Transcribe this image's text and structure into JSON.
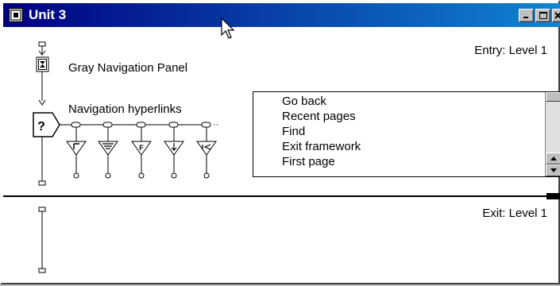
{
  "window": {
    "title": "Unit 3",
    "icon": "framework-icon",
    "controls": [
      "minimize-icon",
      "maximize-icon",
      "close-icon"
    ],
    "title_gradient": [
      "#000080",
      "#1084d0"
    ]
  },
  "flowline": {
    "entry_label": "Entry: Level 1",
    "exit_label": "Exit: Level 1",
    "items": [
      {
        "icon": "display-icon",
        "label": "Gray Navigation Panel"
      },
      {
        "icon": "decision-icon",
        "label": "Navigation hyperlinks"
      }
    ],
    "navigate_icons": [
      "navigate-back-icon",
      "navigate-recent-icon",
      "navigate-find-icon",
      "navigate-exit-icon",
      "navigate-first-icon"
    ]
  },
  "listbox": {
    "items": [
      "Go back",
      "Recent pages",
      "Find",
      "Exit framework",
      "First page"
    ]
  }
}
